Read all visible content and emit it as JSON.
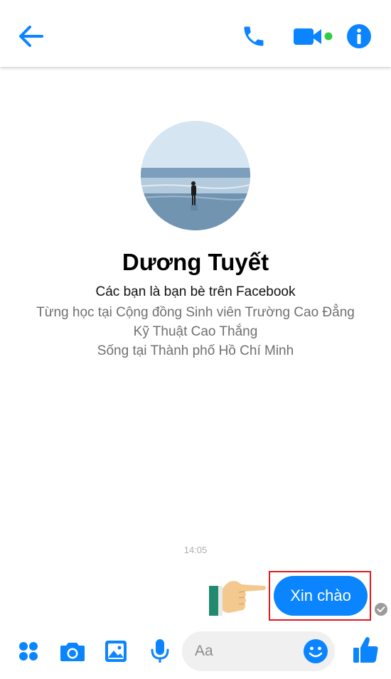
{
  "header": {
    "back_icon": "arrow-left-icon",
    "call_icon": "phone-icon",
    "video_icon": "video-camera-icon",
    "info_icon": "info-icon",
    "accent_color": "#0b84ff",
    "active_status_color": "#31cc46"
  },
  "profile": {
    "name": "Dương Tuyết",
    "friend_status": "Các bạn là bạn bè trên Facebook",
    "education_line1": "Từng học tại Cộng đồng Sinh viên Trường Cao Đẳng",
    "education_line2": "Kỹ Thuật Cao Thắng",
    "location": "Sống tại Thành phố Hồ Chí Minh"
  },
  "conversation": {
    "timestamp": "14:05",
    "message": "Xin chào",
    "bubble_color": "#0b84ff",
    "highlight_color": "#e0171c",
    "seen_icon": "check-circle-icon",
    "pointer_icon": "pointing-hand-icon"
  },
  "composer": {
    "more_icon": "four-dots-icon",
    "camera_icon": "camera-icon",
    "gallery_icon": "image-icon",
    "mic_icon": "microphone-icon",
    "placeholder": "Aa",
    "emoji_icon": "smiley-icon",
    "like_icon": "thumbs-up-icon"
  }
}
